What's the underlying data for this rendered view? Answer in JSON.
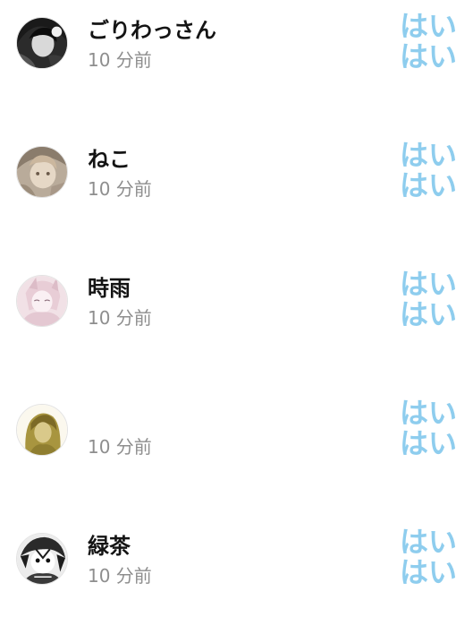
{
  "rows": [
    {
      "name": "ごりわっさん",
      "time": "10 分前",
      "replies": [
        "はい",
        "はい"
      ],
      "avatar_style": "dark-monochrome"
    },
    {
      "name": "ねこ",
      "time": "10 分前",
      "replies": [
        "はい",
        "はい"
      ],
      "avatar_style": "sepia-cherub"
    },
    {
      "name": "時雨",
      "time": "10 分前",
      "replies": [
        "はい",
        "はい"
      ],
      "avatar_style": "pastel-pink-sketch"
    },
    {
      "name": "",
      "time": "10 分前",
      "replies": [
        "はい",
        "はい"
      ],
      "avatar_style": "olive-yellow-figure"
    },
    {
      "name": "緑茶",
      "time": "10 分前",
      "replies": [
        "はい",
        "はい"
      ],
      "avatar_style": "bw-manga"
    }
  ],
  "colors": {
    "name": "#141414",
    "time": "#8e8e8e",
    "reply": "#8ecdee"
  }
}
